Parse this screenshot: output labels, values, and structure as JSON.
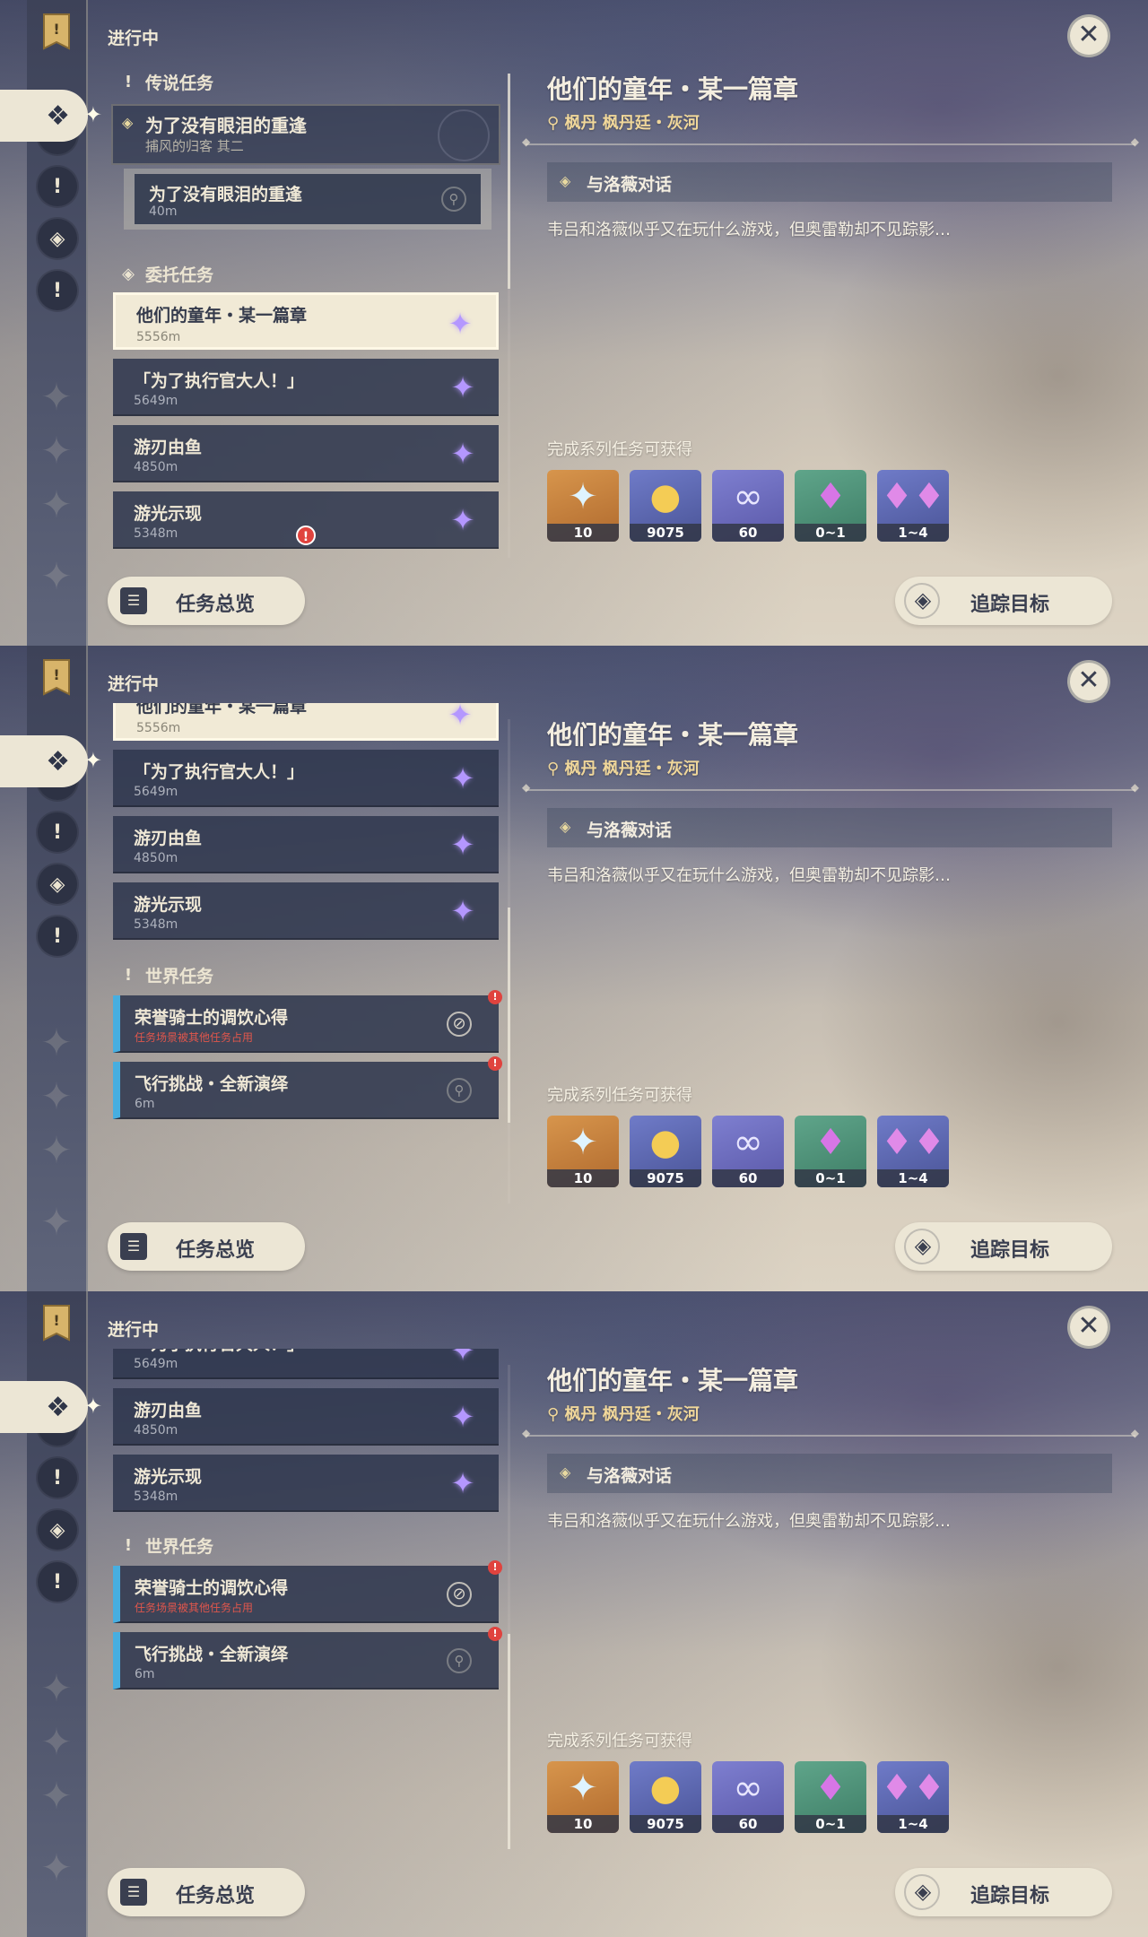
{
  "header": {
    "in_progress": "进行中",
    "close_label": "✕"
  },
  "sections": {
    "legend": "传说任务",
    "commission": "委托任务",
    "world": "世界任务"
  },
  "legend_quest": {
    "title": "为了没有眼泪的重逢",
    "subtitle": "捕风的归客 其二",
    "step_title": "为了没有眼泪的重逢",
    "step_distance": "40m"
  },
  "commission_quests": [
    {
      "title": "他们的童年・某一篇章",
      "distance": "5556m"
    },
    {
      "title": "「为了执行官大人！」",
      "distance": "5649m"
    },
    {
      "title": "游刃由鱼",
      "distance": "4850m"
    },
    {
      "title": "游光示现",
      "distance": "5348m"
    }
  ],
  "world_quests": [
    {
      "title": "荣誉骑士的调饮心得",
      "warning": "任务场景被其他任务占用"
    },
    {
      "title": "飞行挑战・全新演绎",
      "distance": "6m"
    }
  ],
  "detail": {
    "title": "他们的童年・某一篇章",
    "region": "枫丹",
    "location": "枫丹廷・灰河",
    "step": "与洛薇对话",
    "description": "韦吕和洛薇似乎又在玩什么游戏，但奥雷勒却不见踪影…",
    "reward_label": "完成系列任务可获得",
    "rewards": [
      {
        "icon": "primogem-icon",
        "count": "10"
      },
      {
        "icon": "mora-icon",
        "count": "9075"
      },
      {
        "icon": "companionship-exp-icon",
        "count": "60"
      },
      {
        "icon": "crystal-icon",
        "count": "0~1"
      },
      {
        "icon": "crystal-cluster-icon",
        "count": "1~4"
      }
    ]
  },
  "buttons": {
    "overview": "任务总览",
    "track": "追踪目标"
  },
  "colors": {
    "cream": "#ece6d5",
    "navy": "#30384e",
    "gold": "#f0d79a",
    "world_accent": "#47aee0",
    "alert": "#e0433e"
  }
}
